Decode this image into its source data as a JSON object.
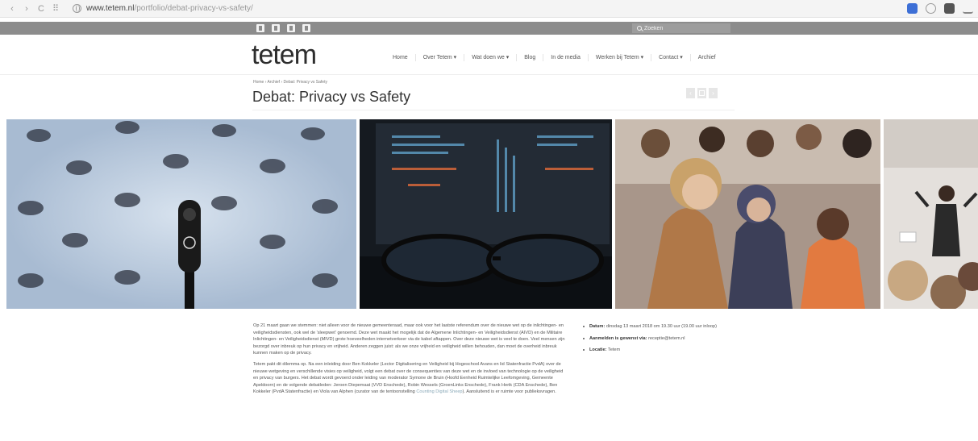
{
  "browser": {
    "url_host": "www.tetem.nl",
    "url_path": "/portfolio/debat-privacy-vs-safety/",
    "back": "‹",
    "forward": "›",
    "reload": "C",
    "apps": "⠿"
  },
  "topbar": {
    "search_placeholder": "Zoeken",
    "social_icons": [
      "facebook-icon",
      "twitter-icon",
      "linkedin-icon",
      "instagram-icon"
    ]
  },
  "header": {
    "logo": "tetem",
    "menu": [
      "Home",
      "Over Tetem ▾",
      "Wat doen we ▾",
      "Blog",
      "In de media",
      "Werken bij Tetem ▾",
      "Contact ▾",
      "Archief"
    ]
  },
  "page": {
    "breadcrumb": "Home › Archief › Debat: Privacy vs Safety",
    "title": "Debat: Privacy vs Safety",
    "pager_prev": "‹",
    "pager_next": "›"
  },
  "content": {
    "p1": "Op 21 maart gaan we stemmen: niet alleen voor de nieuwe gemeenteraad, maar ook voor het laatste referendum over de nieuwe wet op de inlichtingen- en veiligheidsdiensten, ook wel de 'sleepwet' genoemd. Deze wet maakt het mogelijk dat de Algemene Inlichtingen- en Veiligheidsdienst (AIVD) en de Militaire Inlichtingen- en Veiligheidsdienst (MIVD) grote hoeveelheden internetverkeer via de kabel aftappen. Over deze nieuwe wet is veel te doen. Veel mensen zijn bezorgd over inbreuk op hun privacy en vrijheid. Anderen zeggen juist: als we onze vrijheid en veiligheid willen behouden, dan moet de overheid inbreuk kunnen maken op de privacy.",
    "p2_before": "Tetem pakt dit dilemma op. Na een inleiding door Ben Kokkeler (Lector Digitalisering en Veiligheid bij Hogeschool Avans en lid Statenfractie PvdA) over de nieuwe wetgeving en verschillende visies op veiligheid, volgt een debat over de consequenties van deze wet en de invloed van technologie op de veiligheid en privacy van burgers. Het debat wordt gevoerd onder leiding van moderator Symone de Bruin (Hoofd Eenheid Ruimtelijke Leefomgeving, Gemeente Apeldoorn) en de volgende debatleden: Jeroen Diepemaat (VVD Enschede), Robin Wessels (GroenLinks Enschede), Frank Herik (CDA Enschede), Ben Kokkeler (PvdA Statenfractie) en Viola van Alphen (curator van de tentoonstelling ",
    "p2_link": "Counting Digital Sheep",
    "p2_after": "). Aansluitend is er ruimte voor publieksvragen."
  },
  "details": [
    {
      "label": "Datum:",
      "value": "dinsdag 13 maart 2018 om 19.30 uur (19.00 uur inloop)"
    },
    {
      "label": "Aanmelden is gewenst via:",
      "value": "receptie@tetem.nl"
    },
    {
      "label": "Locatie:",
      "value": "Tetem"
    }
  ],
  "colors": {
    "strip": "#8c8c8c",
    "accent_link": "#8aa9b8"
  }
}
